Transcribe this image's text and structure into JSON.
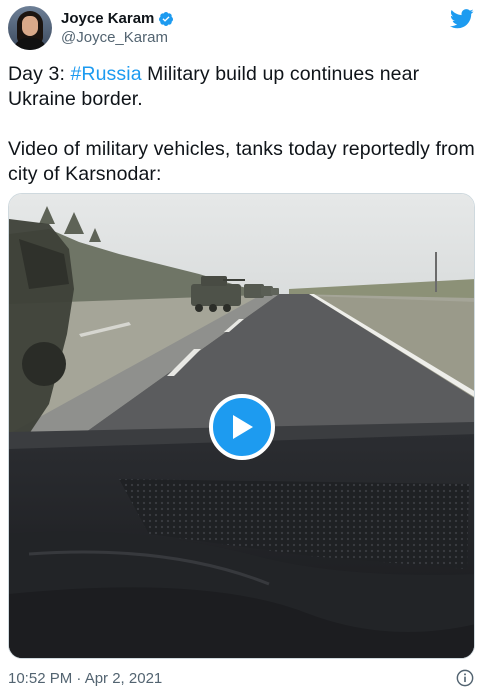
{
  "author": {
    "name": "Joyce Karam",
    "handle": "@Joyce_Karam",
    "verified": true
  },
  "tweet": {
    "line1_prefix": "Day 3: ",
    "hashtag": "#Russia",
    "line1_suffix": " Military build up continues near Ukraine border.",
    "line2": "Video of military vehicles, tanks today reportedly from city of Karsnodar:"
  },
  "media": {
    "type": "video",
    "play_icon": "play-icon"
  },
  "timestamp": "10:52 PM · Apr 2, 2021",
  "icons": {
    "brand": "twitter-bird-icon",
    "info": "info-icon",
    "verified": "verified-badge-icon"
  },
  "colors": {
    "accent": "#1d9bf0",
    "text": "#0f1419",
    "muted": "#536471"
  }
}
